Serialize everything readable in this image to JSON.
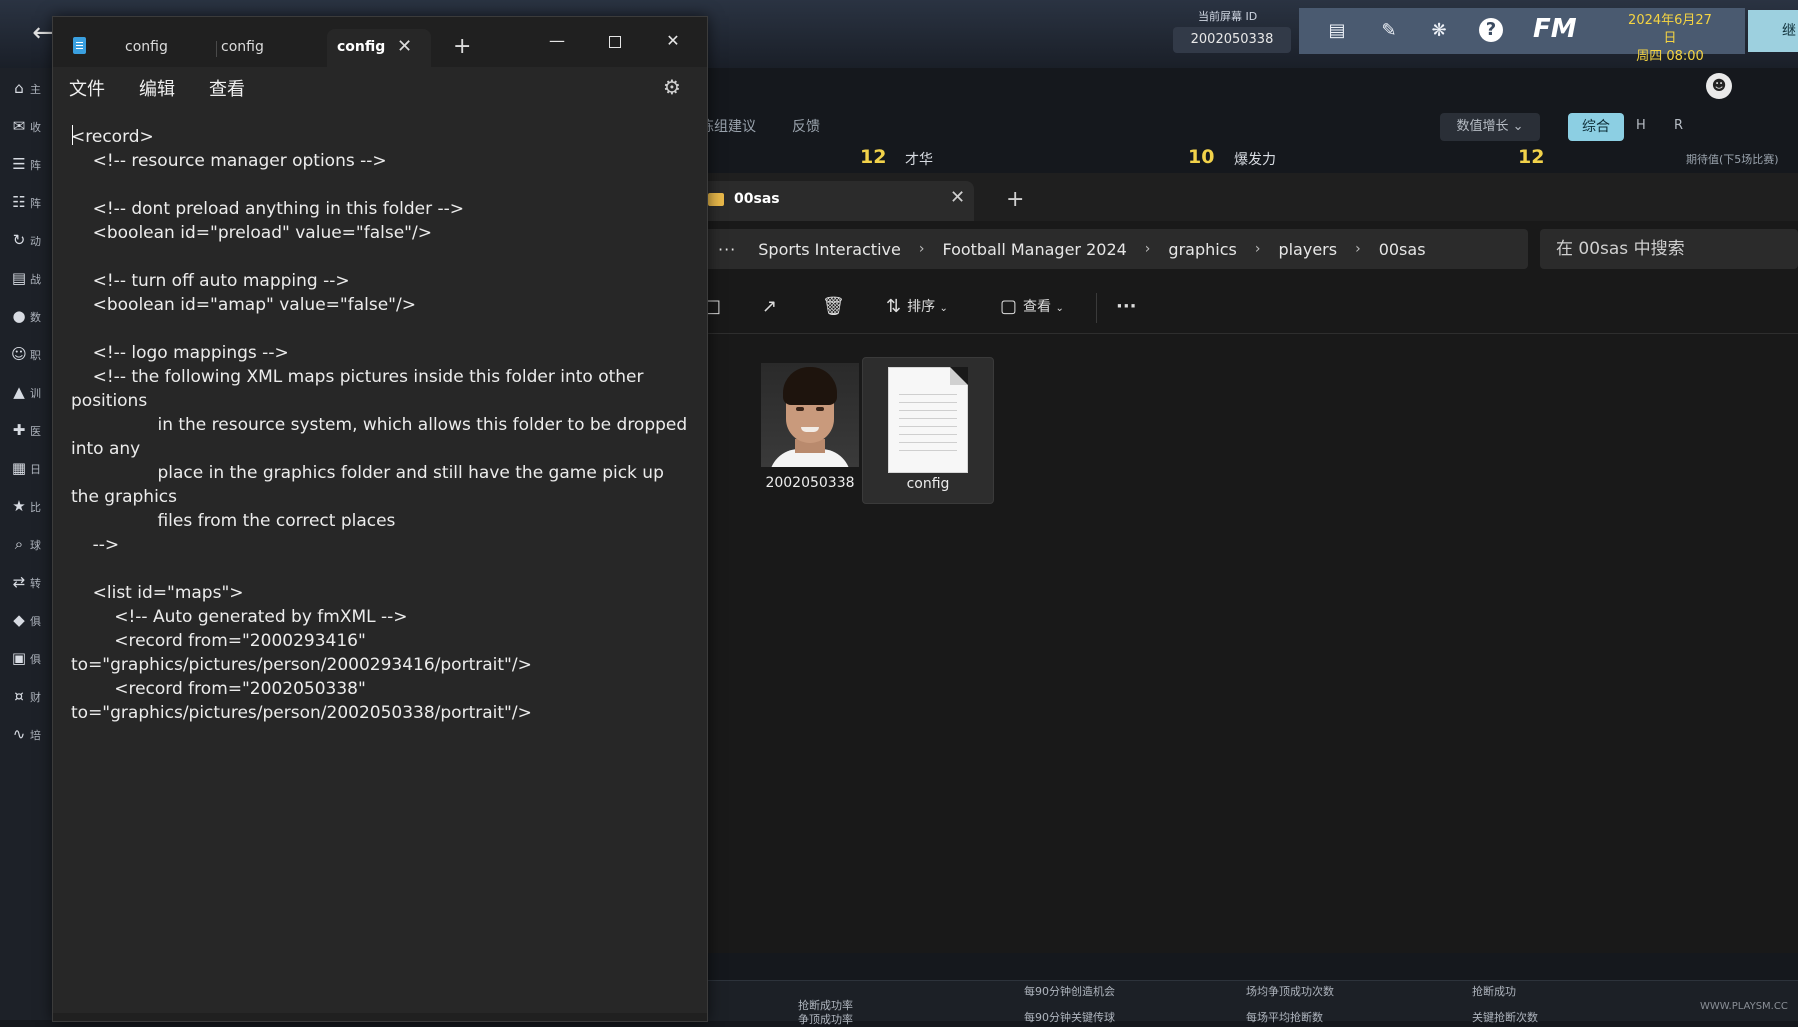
{
  "fm": {
    "back_icon": "back-arrow-icon",
    "screen_label": "当前屏幕 ID",
    "screen_id": "2002050338",
    "toolbar_icons": [
      "id-icon",
      "pencil-icon",
      "brain-icon",
      "help-icon"
    ],
    "help_glyph": "?",
    "logo": "FM",
    "date_line1": "2024年6月27日",
    "date_line2": "周四 08:00",
    "continue_label": "继",
    "sidebar": [
      {
        "icon": "home-icon",
        "label": "主"
      },
      {
        "icon": "inbox-icon",
        "label": "收"
      },
      {
        "icon": "squad-icon",
        "label": "阵"
      },
      {
        "icon": "tactics-icon",
        "label": "阵"
      },
      {
        "icon": "dynamics-icon",
        "label": "动"
      },
      {
        "icon": "analysis-icon",
        "label": "战"
      },
      {
        "icon": "data-icon",
        "label": "数"
      },
      {
        "icon": "staff-icon",
        "label": "职"
      },
      {
        "icon": "training-icon",
        "label": "训"
      },
      {
        "icon": "medical-icon",
        "label": "医"
      },
      {
        "icon": "calendar-icon",
        "label": "日"
      },
      {
        "icon": "trophy-icon",
        "label": "比"
      },
      {
        "icon": "scouting-icon",
        "label": "球"
      },
      {
        "icon": "transfer-icon",
        "label": "转"
      },
      {
        "icon": "club-icon",
        "label": "俱"
      },
      {
        "icon": "club-info-icon",
        "label": "俱"
      },
      {
        "icon": "finance-icon",
        "label": "财"
      },
      {
        "icon": "development-icon",
        "label": "培"
      }
    ],
    "subtabs": [
      "练组建议",
      "反馈"
    ],
    "trend_select": "数值增长",
    "tab_overall": "综合",
    "tab_h": "H",
    "tab_r": "R",
    "attributes": [
      {
        "value": "12",
        "name": "才华"
      },
      {
        "value": "10",
        "name": "爆发力"
      },
      {
        "value": "12",
        "name": ""
      }
    ],
    "expect_note": "期待值(下5场比赛)",
    "bottom_stats": [
      "抢断成功率",
      "每90分钟创造机会",
      "场均争顶成功次数",
      "抢断成功",
      "争顶成功率",
      "每90分钟关键传球",
      "每场平均抢断数",
      "关键抢断次数"
    ],
    "watermark": "WWW.PLAYSM.CC"
  },
  "explorer": {
    "tab_title": "00sas",
    "close_glyph": "✕",
    "newtab_glyph": "+",
    "more_glyph": "···",
    "breadcrumbs": [
      "Sports Interactive",
      "Football Manager 2024",
      "graphics",
      "players",
      "00sas"
    ],
    "search_placeholder": "在 00sas 中搜索",
    "commands": {
      "sort": "排序",
      "view": "查看",
      "more": "···"
    },
    "files": [
      {
        "name": "2002050338",
        "type": "image"
      },
      {
        "name": "config",
        "type": "document"
      }
    ]
  },
  "notepad": {
    "tabs": [
      "config",
      "config",
      "config"
    ],
    "close_glyph": "✕",
    "newtab_glyph": "+",
    "menu": {
      "file": "文件",
      "edit": "编辑",
      "view": "查看"
    },
    "settings_icon": "gear-icon",
    "content": "<record>\n\t<!-- resource manager options -->\n\n\t<!-- dont preload anything in this folder -->\n\t<boolean id=\"preload\" value=\"false\"/>\n\n\t<!-- turn off auto mapping -->\n\t<boolean id=\"amap\" value=\"false\"/>\n\n\t<!-- logo mappings -->\n\t<!-- the following XML maps pictures inside this folder into other positions\n\t\t\t\tin the resource system, which allows this folder to be dropped into any\n\t\t\t\tplace in the graphics folder and still have the game pick up the graphics\n\t\t\t\tfiles from the correct places\n\t-->\n\n\t<list id=\"maps\">\n\t\t<!-- Auto generated by fmXML -->\n\t\t<record from=\"2000293416\" to=\"graphics/pictures/person/2000293416/portrait\"/>\n\t\t<record from=\"2002050338\" to=\"graphics/pictures/person/2002050338/portrait\"/>"
  }
}
